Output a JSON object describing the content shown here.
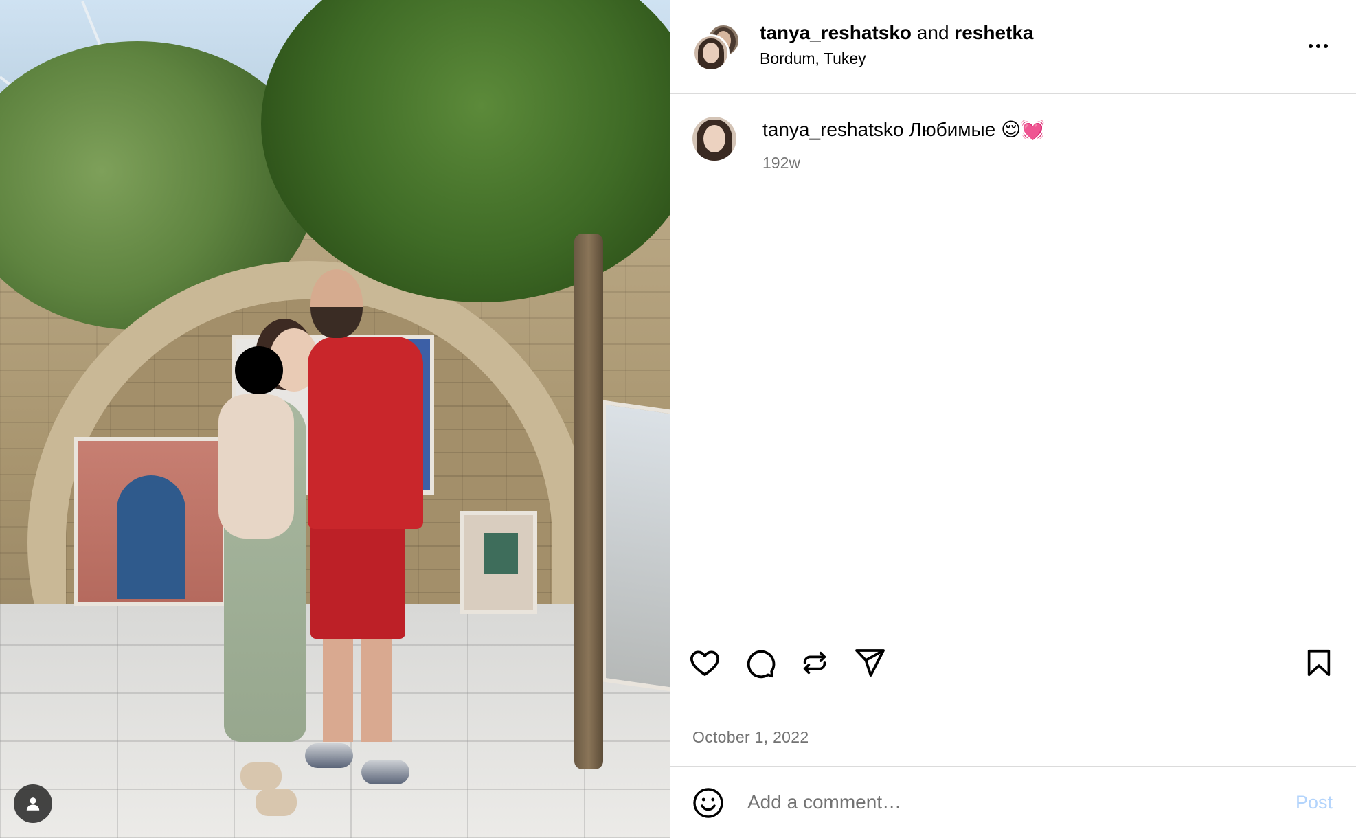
{
  "post": {
    "author_primary": "tanya_reshatsko",
    "joiner": "and",
    "author_secondary": "reshetka",
    "location": "Bordum, Tukey"
  },
  "caption": {
    "username": "tanya_reshatsko",
    "text": "Любимые 😌💓",
    "age": "192w"
  },
  "actions": {
    "like_icon": "heart-icon",
    "comment_icon": "speech-bubble-icon",
    "repost_icon": "repost-icon",
    "share_icon": "paper-plane-icon",
    "save_icon": "bookmark-icon"
  },
  "date": "October 1, 2022",
  "comment": {
    "placeholder": "Add a comment…",
    "post_label": "Post",
    "post_color": "#b3d4fc"
  },
  "colors": {
    "divider": "#dbdbdb",
    "secondary_text": "#737373"
  }
}
